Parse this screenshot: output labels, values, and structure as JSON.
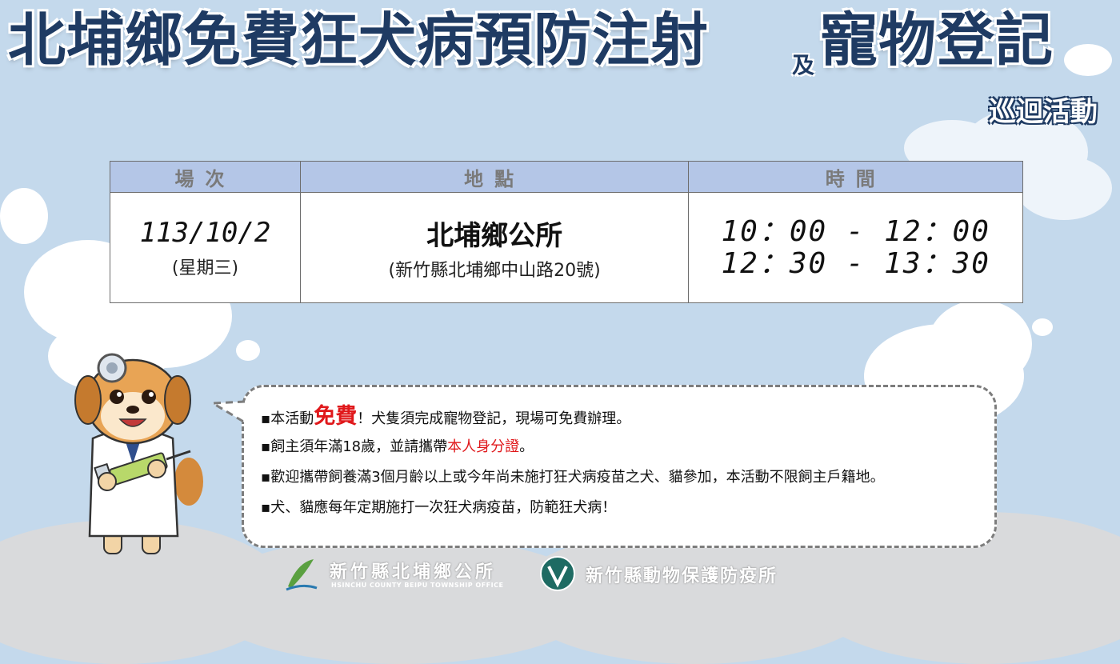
{
  "header": {
    "title_main": "北埔鄉免費狂犬病預防注射",
    "title_connector": "及",
    "title_tail": "寵物登記",
    "subtitle": "巡迴活動"
  },
  "schedule": {
    "headers": [
      "場次",
      "地點",
      "時間"
    ],
    "row": {
      "date": "113/10/2",
      "weekday": "(星期三)",
      "place": "北埔鄉公所",
      "address": "(新竹縣北埔鄉中山路20號)",
      "time_1": "10：00 - 12：00",
      "time_2": "12：30 - 13：30"
    }
  },
  "notes": {
    "n1_pre": "本活動",
    "n1_highlight": "免費",
    "n1_post": "！犬隻須完成寵物登記，現場可免費辦理。",
    "n2_pre": "飼主須年滿18歲，並請攜帶",
    "n2_highlight": "本人身分證",
    "n2_post": "。",
    "n3": "歡迎攜帶飼養滿3個月齡以上或今年尚未施打狂犬病疫苗之犬、貓參加，本活動不限飼主戶籍地。",
    "n4": "犬、貓應每年定期施打一次狂犬病疫苗，防範狂犬病！"
  },
  "footer": {
    "org1": "新竹縣北埔鄉公所",
    "org1_en": "HSINCHU COUNTY BEIPU TOWNSHIP OFFICE",
    "org1_mark": "北埔",
    "org2": "新竹縣動物保護防疫所"
  },
  "colors": {
    "background": "#c4d9ec",
    "title": "#1f3b63",
    "table_header": "#b4c6e7",
    "highlight": "#e0181b"
  },
  "icons": [
    "dog-doctor-mascot",
    "head-mirror-icon",
    "syringe-icon",
    "beipu-logo-icon",
    "animal-protection-logo-icon"
  ]
}
